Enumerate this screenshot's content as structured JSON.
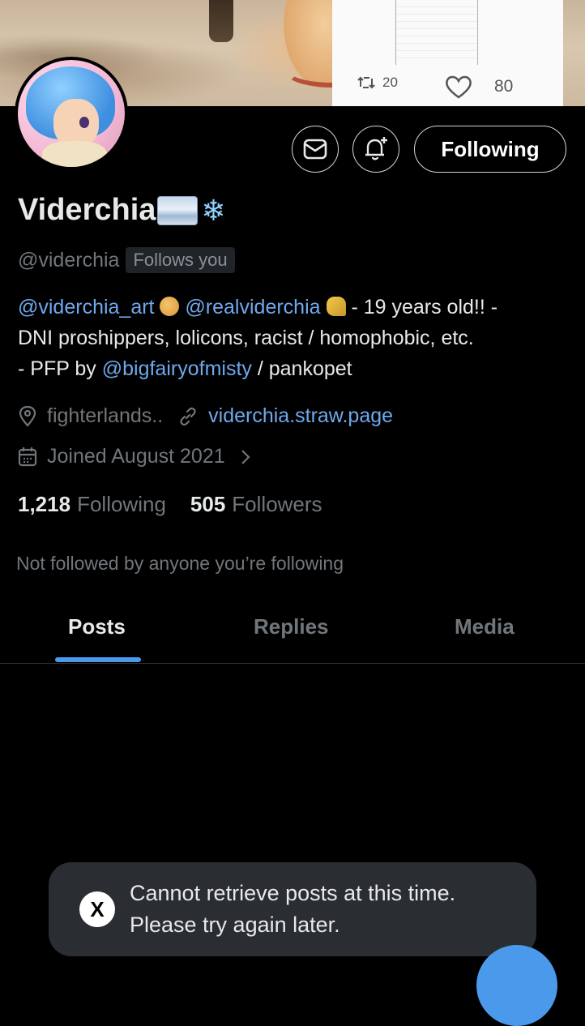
{
  "banner": {
    "retweet_count": "20",
    "like_count": "80"
  },
  "actions": {
    "follow_label": "Following"
  },
  "profile": {
    "display_name": "Viderchia",
    "handle": "@viderchia",
    "follows_you": "Follows you",
    "bio": {
      "mention1": "@viderchia_art",
      "mention2": "@realviderchia",
      "text1": "- 19 years old!! -",
      "text2": "DNI proshippers, lolicons, racist / homophobic, etc.",
      "text3_prefix": "- PFP by ",
      "mention3": "@bigfairyofmisty",
      "text3_suffix": " / pankopet"
    },
    "location": "fighterlands..",
    "website": "viderchia.straw.page",
    "joined": "Joined August 2021",
    "following_count": "1,218",
    "following_label": "Following",
    "followers_count": "505",
    "followers_label": "Followers",
    "not_followed": "Not followed by anyone you’re following"
  },
  "tabs": [
    {
      "label": "Posts"
    },
    {
      "label": "Replies"
    },
    {
      "label": "Media"
    }
  ],
  "toast": {
    "line1": "Cannot retrieve posts at this time.",
    "line2": "Please try again later.",
    "logo": "X"
  },
  "colors": {
    "accent": "#4b99ea",
    "link": "#6fa8ec",
    "muted": "#71767b",
    "background": "#000000"
  }
}
